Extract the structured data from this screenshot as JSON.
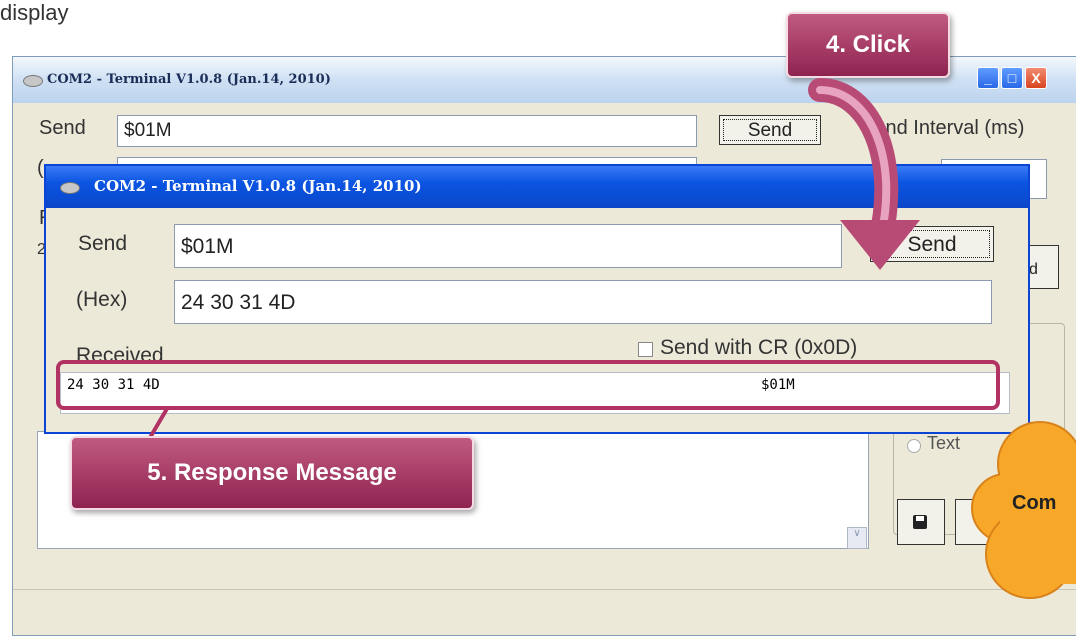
{
  "caption": "display",
  "back_window": {
    "title": "COM2 - Terminal V1.0.8 (Jan.14, 2010)",
    "send_label": "Send",
    "send_value": "$01M",
    "send_button": "Send",
    "interval_label": "Send Interval (ms)",
    "hex_label_fragment": "(",
    "received_fragment": "R",
    "received_value_fragment": "2",
    "send_ed_fragment": "ed",
    "text_radio": "Text",
    "minimize": "_",
    "maximize": "□",
    "close": "X"
  },
  "front_window": {
    "title": "COM2 - Terminal V1.0.8 (Jan.14, 2010)",
    "send_label": "Send",
    "send_value": "$01M",
    "send_button": "Send",
    "hex_label": "(Hex)",
    "hex_value": "24 30 31 4D",
    "cr_label": "Send with CR (0x0D)",
    "received_label": "Received",
    "received_hex": "24 30 31 4D",
    "received_ascii": "$01M"
  },
  "callouts": {
    "step4": "4. Click",
    "step5": "5. Response Message",
    "cloud": "Com"
  },
  "colors": {
    "callout": "#a83a66",
    "xp_blue": "#0a50dc",
    "cloud": "#f8a828"
  }
}
